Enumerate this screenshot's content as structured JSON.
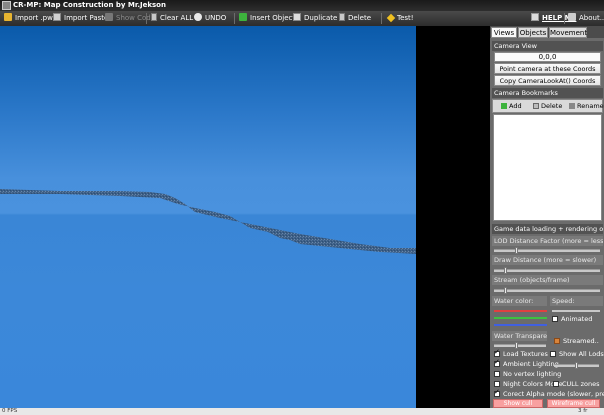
{
  "window": {
    "title": "CR-MP: Map Construction by Mr.Jekson"
  },
  "toolbar": {
    "import_pwn": "Import .pwn",
    "import_paste": "Import Paste",
    "show_code": "Show Code",
    "clear_all": "Clear ALL",
    "undo": "UNDO",
    "insert_object": "Insert Object",
    "duplicate": "Duplicate",
    "delete": "Delete",
    "test": "Test!",
    "help_me": "HELP ME",
    "about": "About..."
  },
  "tabs": [
    "Views",
    "Objects",
    "Movement"
  ],
  "camera_view": {
    "header": "Camera View",
    "coords": "0,0,0",
    "point_button": "Point camera at these Coords",
    "copy_button": "Copy CameraLookAt() Coords"
  },
  "bookmarks": {
    "header": "Camera Bookmarks",
    "add": "Add",
    "delete": "Delete",
    "rename": "Rename"
  },
  "game_data": {
    "header": "Game data loading + rendering options",
    "lod_label": "LOD Distance Factor (more = less LODs)",
    "draw_distance_label": "Draw Distance (more = slower)",
    "stream_label": "Stream (objects/frame)",
    "water_color_label": "Water color:",
    "speed_label": "Speed:",
    "animated_label": "Animated",
    "water_transparency_label": "Water Transparency",
    "streamed_label": "Streamed..",
    "load_textures": "Load Textures",
    "show_all_lods": "Show All Lods",
    "ambient_lighting": "Ambient Lighting",
    "no_vertex_lighting": "No vertex lighting",
    "night_colors": "Night Colors Mode",
    "cull_zones": "CULL zones",
    "correct_alpha": "Corect Alpha mode (slower, prettier)",
    "sliders": {
      "lod": 0.2,
      "draw_distance": 0.1,
      "stream": 0.1,
      "speed": 0.4,
      "transparency": 0.4,
      "ambient": 0.5
    }
  },
  "bottom_buttons": {
    "left": "Show cull",
    "right": "Wireframe cull"
  },
  "status": {
    "left": "0 FPS",
    "right": "3 fr"
  },
  "colors": {
    "accent_green": "#3db33d",
    "sky": "#2a77c8",
    "water": "#3a87da",
    "panel": "#6b6b6b"
  }
}
